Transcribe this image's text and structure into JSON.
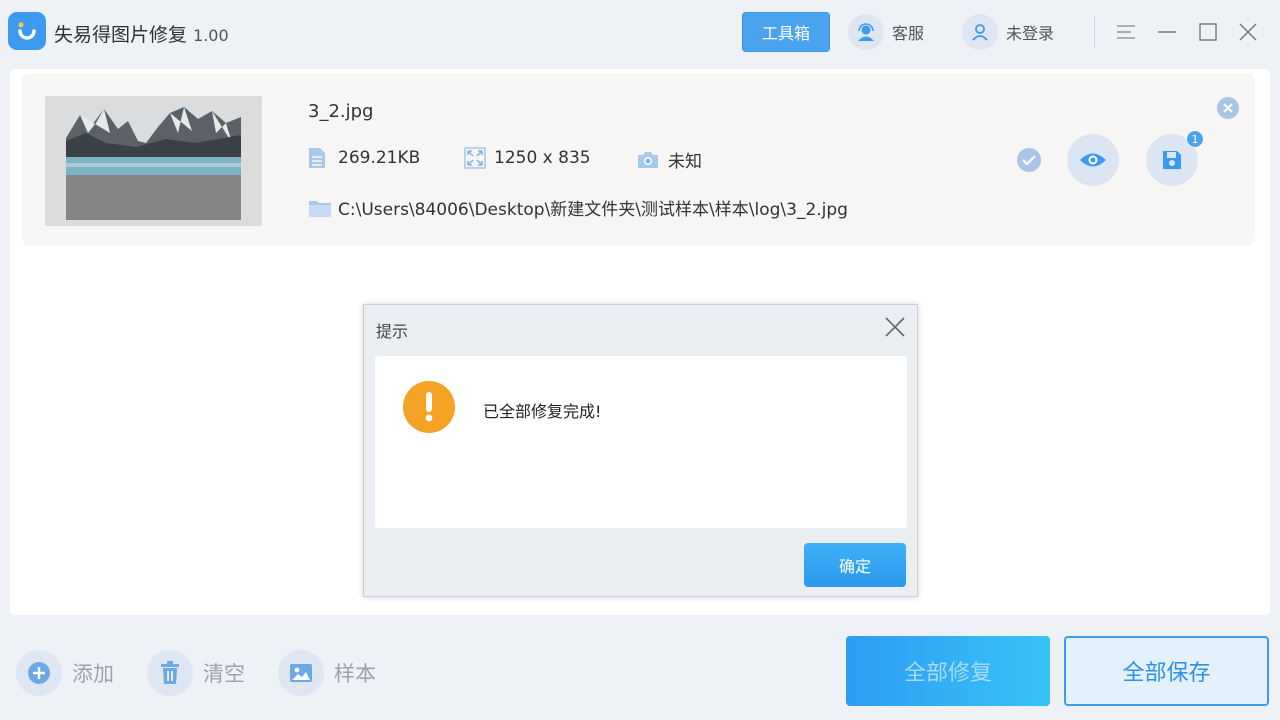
{
  "app": {
    "title": "失易得图片修复",
    "version": "1.00"
  },
  "header": {
    "tools_label": "工具箱",
    "service_label": "客服",
    "login_label": "未登录"
  },
  "file": {
    "name": "3_2.jpg",
    "size": "269.21KB",
    "dimensions": "1250 x 835",
    "camera": "未知",
    "path": "C:\\Users\\84006\\Desktop\\新建文件夹\\测试样本\\样本\\log\\3_2.jpg",
    "save_count": "1"
  },
  "dialog": {
    "title": "提示",
    "message": "已全部修复完成!",
    "ok_label": "确定"
  },
  "footer": {
    "add_label": "添加",
    "clear_label": "清空",
    "sample_label": "样本",
    "repair_all_label": "全部修复",
    "save_all_label": "全部保存"
  },
  "colors": {
    "accent": "#3c9bf0",
    "warning": "#f5a325",
    "background": "#eef1f6"
  }
}
